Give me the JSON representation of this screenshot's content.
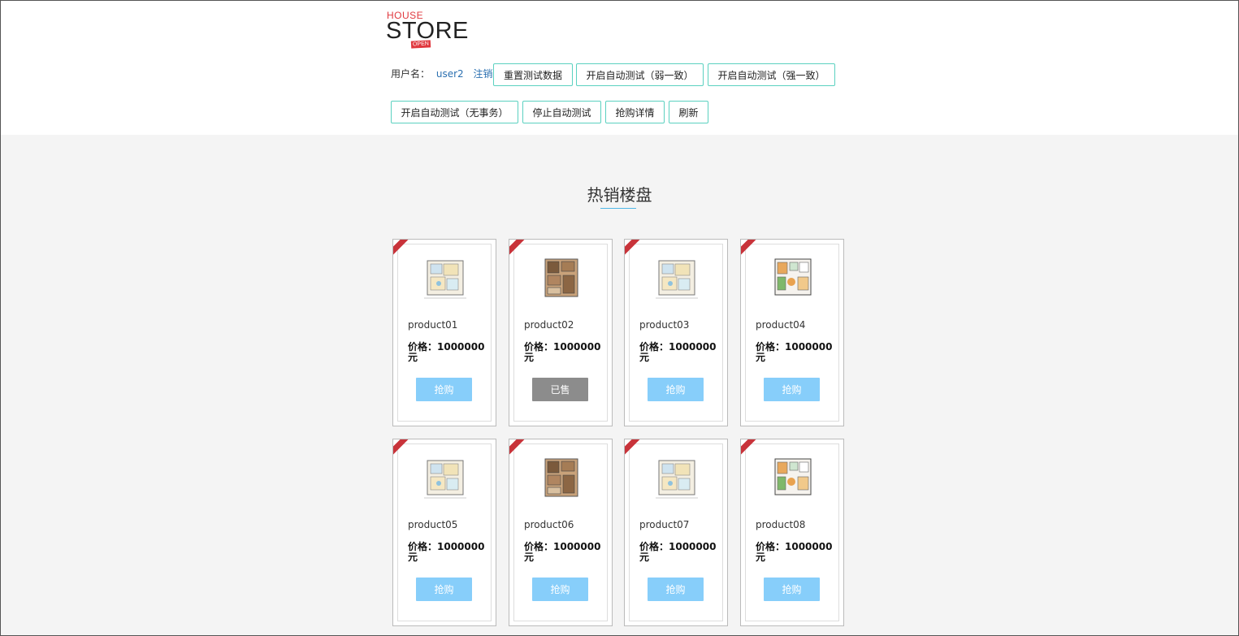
{
  "brand": {
    "top": "HOUSE",
    "main": "STORE",
    "badge": "OPEN"
  },
  "user": {
    "label": "用户名：",
    "name": "user2",
    "logout": "注销"
  },
  "buttons": {
    "reset": "重置测试数据",
    "auto_weak": "开启自动测试（弱一致）",
    "auto_strong": "开启自动测试（强一致）",
    "auto_none": "开启自动测试（无事务）",
    "stop": "停止自动测试",
    "details": "抢购详情",
    "refresh": "刷新"
  },
  "section": {
    "title": "热销楼盘"
  },
  "products": [
    {
      "name": "product01",
      "price": "价格：1000000元",
      "action": "抢购",
      "sold": false
    },
    {
      "name": "product02",
      "price": "价格：1000000元",
      "action": "已售",
      "sold": true
    },
    {
      "name": "product03",
      "price": "价格：1000000元",
      "action": "抢购",
      "sold": false
    },
    {
      "name": "product04",
      "price": "价格：1000000元",
      "action": "抢购",
      "sold": false
    },
    {
      "name": "product05",
      "price": "价格：1000000元",
      "action": "抢购",
      "sold": false
    },
    {
      "name": "product06",
      "price": "价格：1000000元",
      "action": "抢购",
      "sold": false
    },
    {
      "name": "product07",
      "price": "价格：1000000元",
      "action": "抢购",
      "sold": false
    },
    {
      "name": "product08",
      "price": "价格：1000000元",
      "action": "抢购",
      "sold": false
    }
  ],
  "colors": {
    "accent_border": "#5bd1c0",
    "buy": "#87cefa",
    "sold": "#8c8c8c",
    "brand_red": "#e0383e"
  }
}
